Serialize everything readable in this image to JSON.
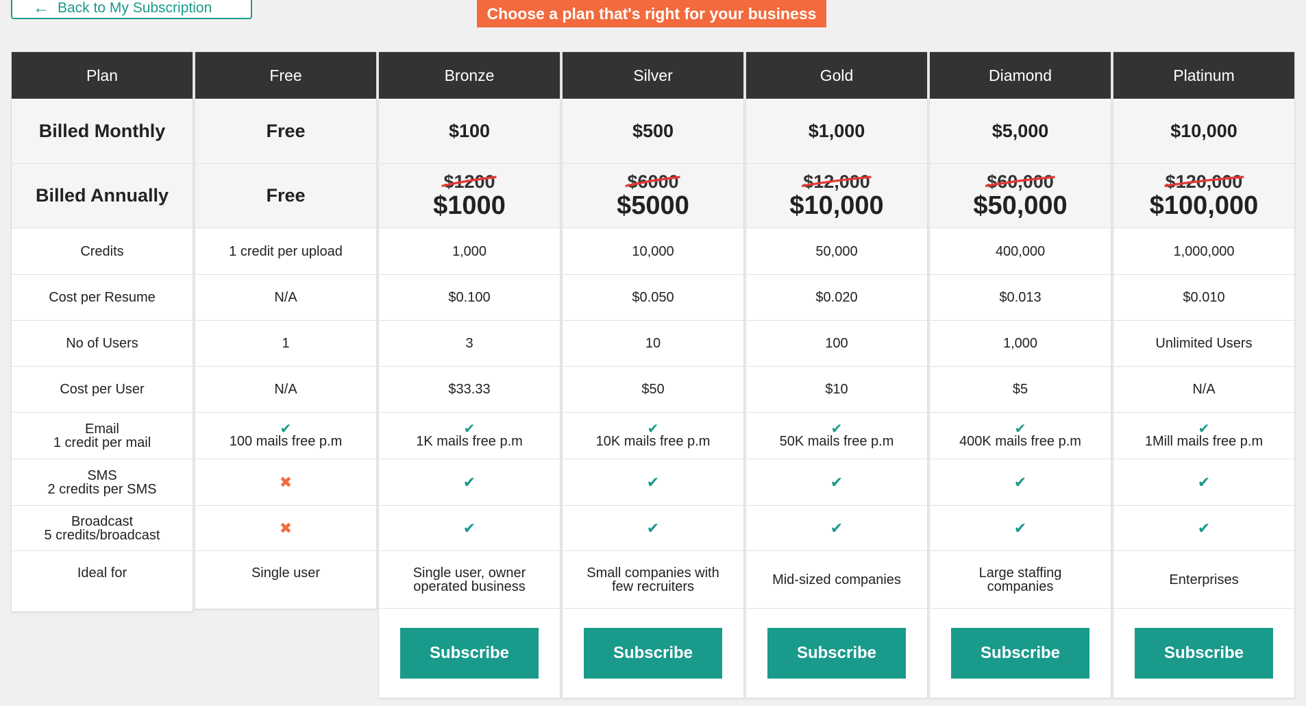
{
  "back_label": "Back to My Subscription",
  "banner": "Choose a plan that's right for your business",
  "row_labels": {
    "plan": "Plan",
    "monthly": "Billed Monthly",
    "annually": "Billed Annually",
    "credits": "Credits",
    "cost_resume": "Cost per Resume",
    "users": "No of Users",
    "cost_user": "Cost per User",
    "email_1": "Email",
    "email_2": "1 credit per mail",
    "sms_1": "SMS",
    "sms_2": "2 credits per SMS",
    "broadcast_1": "Broadcast",
    "broadcast_2": "5 credits/broadcast",
    "ideal": "Ideal for"
  },
  "plans": [
    {
      "name": "Free",
      "monthly": "Free",
      "annual_old": "",
      "annual": "Free",
      "credits": "1 credit per upload",
      "cost_resume": "N/A",
      "users": "1",
      "cost_user": "N/A",
      "email": "100 mails free p.m",
      "sms": false,
      "broadcast": false,
      "ideal": "Single user",
      "subscribe": ""
    },
    {
      "name": "Bronze",
      "monthly": "$100",
      "annual_old": "$1200",
      "annual": "$1000",
      "credits": "1,000",
      "cost_resume": "$0.100",
      "users": "3",
      "cost_user": "$33.33",
      "email": "1K mails free p.m",
      "sms": true,
      "broadcast": true,
      "ideal": "Single user, owner operated business",
      "subscribe": "Subscribe"
    },
    {
      "name": "Silver",
      "monthly": "$500",
      "annual_old": "$6000",
      "annual": "$5000",
      "credits": "10,000",
      "cost_resume": "$0.050",
      "users": "10",
      "cost_user": "$50",
      "email": "10K mails free p.m",
      "sms": true,
      "broadcast": true,
      "ideal": "Small companies with few recruiters",
      "subscribe": "Subscribe"
    },
    {
      "name": "Gold",
      "monthly": "$1,000",
      "annual_old": "$12,000",
      "annual": "$10,000",
      "credits": "50,000",
      "cost_resume": "$0.020",
      "users": "100",
      "cost_user": "$10",
      "email": "50K mails free p.m",
      "sms": true,
      "broadcast": true,
      "ideal": "Mid-sized companies",
      "subscribe": "Subscribe"
    },
    {
      "name": "Diamond",
      "monthly": "$5,000",
      "annual_old": "$60,000",
      "annual": "$50,000",
      "credits": "400,000",
      "cost_resume": "$0.013",
      "users": "1,000",
      "cost_user": "$5",
      "email": "400K mails free p.m",
      "sms": true,
      "broadcast": true,
      "ideal": "Large staffing companies",
      "subscribe": "Subscribe"
    },
    {
      "name": "Platinum",
      "monthly": "$10,000",
      "annual_old": "$120,000",
      "annual": "$100,000",
      "credits": "1,000,000",
      "cost_resume": "$0.010",
      "users": "Unlimited Users",
      "cost_user": "N/A",
      "email": "1Mill mails free p.m",
      "sms": true,
      "broadcast": true,
      "ideal": "Enterprises",
      "subscribe": "Subscribe"
    }
  ],
  "colors": {
    "accent": "#1a9a8b",
    "banner": "#f26a3d",
    "header": "#333333"
  },
  "icons": {
    "check": "check-icon",
    "cross": "cross-icon",
    "back": "arrow-left-icon"
  }
}
